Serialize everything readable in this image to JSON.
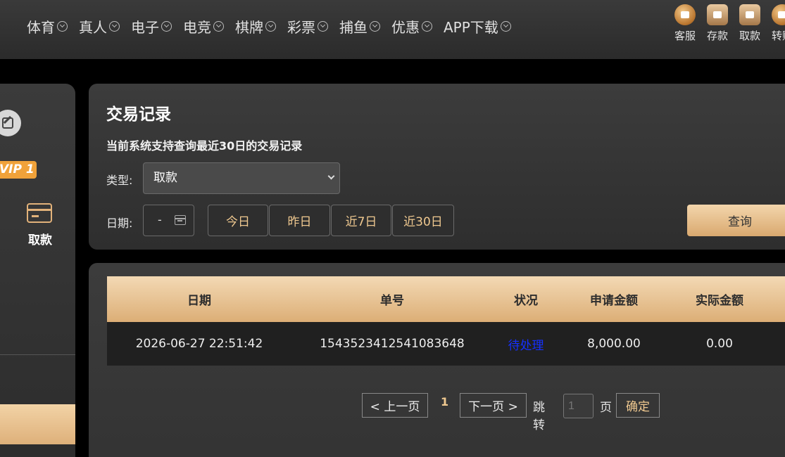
{
  "nav": {
    "items": [
      {
        "label": "体育"
      },
      {
        "label": "真人"
      },
      {
        "label": "电子"
      },
      {
        "label": "电竞"
      },
      {
        "label": "棋牌"
      },
      {
        "label": "彩票"
      },
      {
        "label": "捕鱼"
      },
      {
        "label": "优惠"
      },
      {
        "label": "APP下载"
      }
    ],
    "quick": [
      {
        "label": "客服",
        "icon": "customer-service-icon"
      },
      {
        "label": "存款",
        "icon": "deposit-wallet-icon"
      },
      {
        "label": "取款",
        "icon": "withdraw-wallet-icon"
      },
      {
        "label": "转账",
        "icon": "transfer-icon"
      }
    ]
  },
  "sidebar": {
    "vip": "VIP 1",
    "withdraw_label": "取款"
  },
  "filter": {
    "title": "交易记录",
    "subtitle": "当前系统支持查询最近30日的交易记录",
    "type_label": "类型:",
    "type_value": "取款",
    "date_label": "日期:",
    "date_value": "-",
    "ranges": [
      "今日",
      "昨日",
      "近7日",
      "近30日"
    ],
    "query_label": "查询"
  },
  "table": {
    "headers": [
      "日期",
      "单号",
      "状况",
      "申请金额",
      "实际金额"
    ],
    "rows": [
      {
        "date": "2026-06-27 22:51:42",
        "order_no": "1543523412541083648",
        "status": "待处理",
        "requested": "8,000.00",
        "actual": "0.00"
      }
    ]
  },
  "pager": {
    "prev": "< 上一页",
    "current": "1",
    "next": "下一页 >",
    "jump_label": "跳转",
    "jump_placeholder": "1",
    "page_suffix": "页",
    "confirm": "确定"
  },
  "colors": {
    "accent_gold": "#deb07a",
    "status_link": "#1530ff",
    "vip_orange": "#f0a23a"
  }
}
